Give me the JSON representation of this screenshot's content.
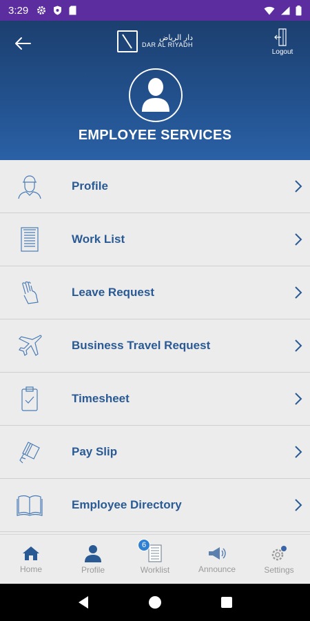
{
  "status_bar": {
    "time": "3:29"
  },
  "header": {
    "logo_arabic": "دار الرياض",
    "logo_english": "DAR AL RIYADH",
    "logout_label": "Logout",
    "title": "EMPLOYEE SERVICES"
  },
  "menu": [
    {
      "label": "Profile",
      "icon": "person-icon"
    },
    {
      "label": "Work List",
      "icon": "document-list-icon"
    },
    {
      "label": "Leave Request",
      "icon": "hand-icon"
    },
    {
      "label": "Business Travel Request",
      "icon": "airplane-icon"
    },
    {
      "label": "Timesheet",
      "icon": "clipboard-check-icon"
    },
    {
      "label": "Pay Slip",
      "icon": "card-in-hand-icon"
    },
    {
      "label": "Employee Directory",
      "icon": "book-icon"
    }
  ],
  "bottom_nav": {
    "home": "Home",
    "profile": "Profile",
    "worklist": "Worklist",
    "worklist_badge": "6",
    "announce": "Announce",
    "settings": "Settings"
  },
  "colors": {
    "header_top": "#1c3f6f",
    "header_bottom": "#2a61a6",
    "accent_blue": "#2a5a93",
    "status_bar": "#5b2d9e",
    "badge": "#2f7fd3"
  }
}
